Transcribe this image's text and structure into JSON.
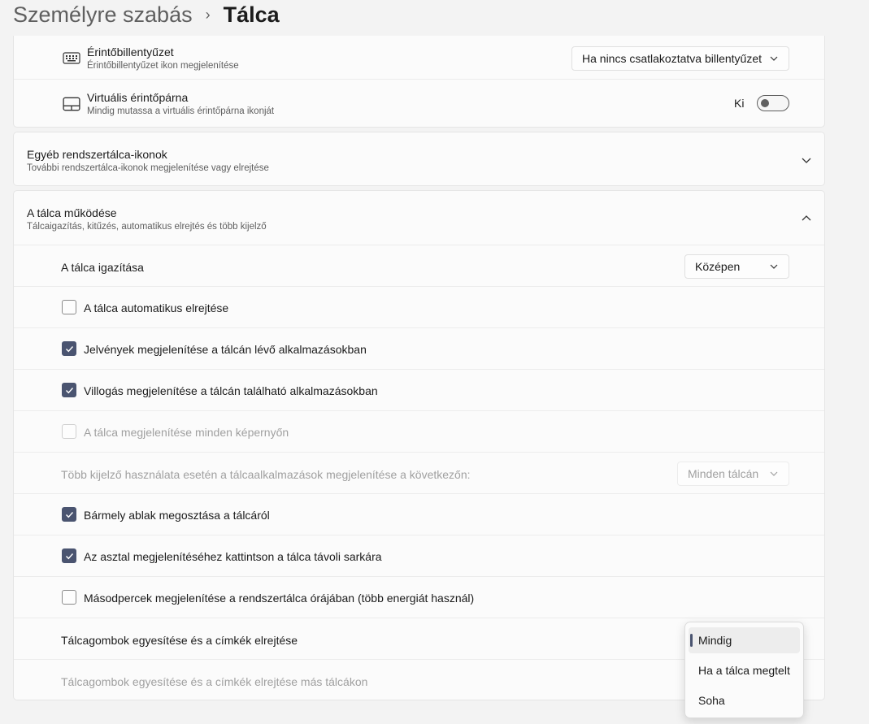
{
  "header": {
    "parent": "Személyre szabás",
    "separator": "›",
    "current": "Tálca"
  },
  "top_card": {
    "touch_keyboard": {
      "title": "Érintőbillentyűzet",
      "subtitle": "Érintőbillentyűzet ikon megjelenítése",
      "dropdown": "Ha nincs csatlakoztatva billentyűzet",
      "icon": "keyboard-icon"
    },
    "virtual_touchpad": {
      "title": "Virtuális érintőpárna",
      "subtitle": "Mindig mutassa a virtuális érintőpárna ikonját",
      "toggle_label": "Ki",
      "toggle_on": false,
      "icon": "touchpad-icon"
    }
  },
  "other_tray": {
    "title": "Egyéb rendszertálca-ikonok",
    "subtitle": "További rendszertálca-ikonok megjelenítése vagy elrejtése",
    "expanded": false
  },
  "behaviors": {
    "title": "A tálca működése",
    "subtitle": "Tálcaigazítás, kitűzés, automatikus elrejtés és több kijelző",
    "expanded": true,
    "alignment": {
      "label": "A tálca igazítása",
      "value": "Középen"
    },
    "auto_hide": {
      "label": "A tálca automatikus elrejtése",
      "checked": false
    },
    "badges": {
      "label": "Jelvények megjelenítése a tálcán lévő alkalmazásokban",
      "checked": true
    },
    "flashing": {
      "label": "Villogás megjelenítése a tálcán található alkalmazásokban",
      "checked": true
    },
    "all_displays": {
      "label": "A tálca megjelenítése minden képernyőn",
      "checked": false,
      "disabled": true
    },
    "multi_display": {
      "label": "Több kijelző használata esetén a tálcaalkalmazások megjelenítése a következőn:",
      "value": "Minden tálcán",
      "disabled": true
    },
    "share_window": {
      "label": "Bármely ablak megosztása a tálcáról",
      "checked": true
    },
    "far_corner": {
      "label": "Az asztal megjelenítéséhez kattintson a tálca távoli sarkára",
      "checked": true
    },
    "seconds": {
      "label": "Másodpercek megjelenítése a rendszertálca órájában (több energiát használ)",
      "checked": false
    },
    "combine": {
      "label": "Tálcagombok egyesítése és a címkék elrejtése"
    },
    "combine_other": {
      "label": "Tálcagombok egyesítése és a címkék elrejtése más tálcákon",
      "disabled": true
    }
  },
  "flyout": {
    "options": [
      "Mindig",
      "Ha a tálca megtelt",
      "Soha"
    ],
    "selected": "Mindig"
  },
  "colors": {
    "accent": "#4a5470",
    "background": "#f3f3f3",
    "card": "#fbfbfb"
  }
}
